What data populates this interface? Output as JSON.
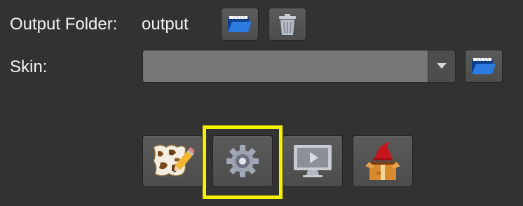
{
  "output": {
    "label": "Output Folder:",
    "value": "output",
    "browse_icon": "folder-open-icon",
    "clear_icon": "trash-icon"
  },
  "skin": {
    "label": "Skin:",
    "selected": "",
    "dropdown_icon": "chevron-down-icon",
    "browse_icon": "folder-open-icon"
  },
  "toolbar": {
    "items": [
      {
        "icon": "map-edit-icon"
      },
      {
        "icon": "gear-icon",
        "highlighted": true
      },
      {
        "icon": "monitor-play-icon"
      },
      {
        "icon": "wizard-box-icon"
      }
    ]
  },
  "colors": {
    "background": "#323232",
    "highlight": "#f5f200",
    "folder_blue": "#1e64c8"
  }
}
